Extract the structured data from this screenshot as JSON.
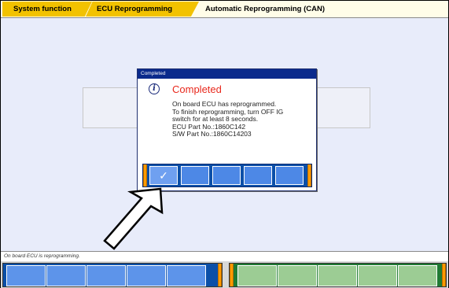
{
  "breadcrumb": {
    "items": [
      "System function",
      "ECU Reprogramming",
      "Automatic Reprogramming (CAN)"
    ]
  },
  "dialog": {
    "title": "Completed",
    "heading": "Completed",
    "message_lines": [
      "On board ECU has reprogrammed.",
      "To finish reprogramming, turn OFF IG",
      "switch for at least 8 seconds.",
      "ECU Part No.:1860C142",
      "S/W Part No.:1860C14203"
    ],
    "ok_icon": "checkmark-icon",
    "colors": {
      "titlebar": "#0a2a8c",
      "heading": "#e8281c",
      "button_bar": "#0b4fa8"
    }
  },
  "status": {
    "text": "On board ECU is reprogramming."
  },
  "icons": {
    "info": "info-icon",
    "pointer": "arrow-pointer-icon"
  },
  "function_keys": {
    "blue_count": 5,
    "green_count": 5,
    "colors": {
      "blue": "#0b4fa8",
      "green": "#1f7a33",
      "cap": "#ff9a00"
    }
  }
}
